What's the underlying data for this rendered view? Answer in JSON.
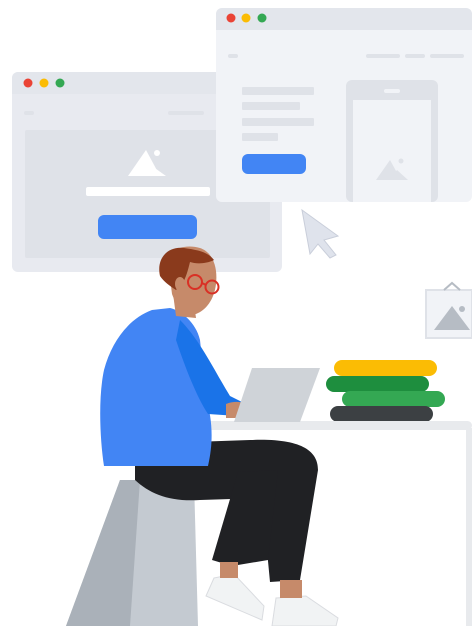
{
  "scene": {
    "description_name": "developer-illustration",
    "colors": {
      "window_frame": "#e8eaf0",
      "window_body": "#f1f3f7",
      "window_titlebar": "#e3e6ec",
      "placeholder": "#dfe2e8",
      "accent_blue": "#4285f4",
      "dot_red": "#ea4335",
      "dot_yellow": "#fbbc04",
      "dot_green": "#34a853",
      "shirt_blue": "#4285f4",
      "skin": "#c68a6a",
      "hair": "#8a3a1c",
      "glasses": "#d93025",
      "pants": "#202124",
      "stool": "#b6bcc4",
      "desk": "#e8eaed",
      "laptop": "#cfd3d8",
      "book_yellow": "#fbbc04",
      "book_dark_green": "#1e8e3e",
      "book_green": "#34a853",
      "book_navy": "#3c4043",
      "shoe": "#f1f3f4",
      "cursor": "#dfe3ec"
    },
    "icons": [
      "window-close-dot-icon",
      "window-minimize-dot-icon",
      "window-maximize-dot-icon",
      "image-placeholder-icon",
      "mouse-cursor-icon"
    ]
  }
}
